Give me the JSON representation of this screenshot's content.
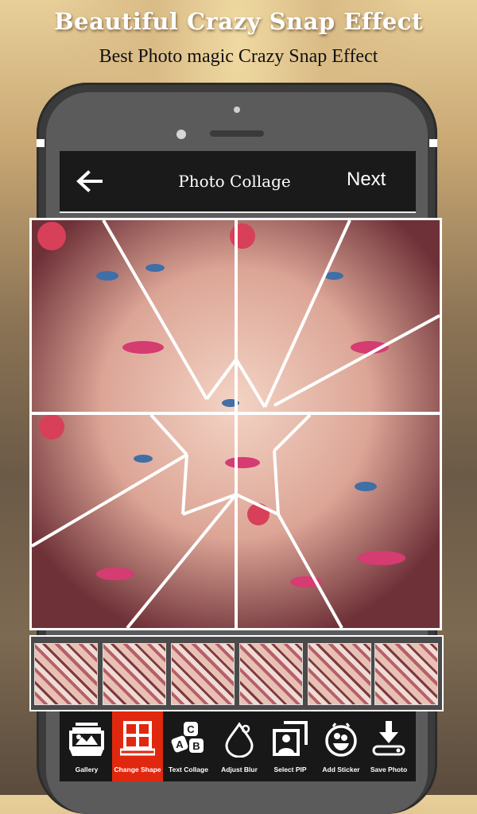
{
  "promo": {
    "title": "Beautiful Crazy Snap Effect",
    "subtitle": "Best Photo magic Crazy Snap Effect"
  },
  "appbar": {
    "back_icon": "arrow-left-icon",
    "title": "Photo Collage",
    "next_label": "Next"
  },
  "collage": {
    "description": "Crazy snap shattered-glass collage of portrait photo",
    "pieces": 11
  },
  "shapes": {
    "thumbnails": [
      {
        "name": "shape-grid-4x3"
      },
      {
        "name": "shape-vertical-shards"
      },
      {
        "name": "shape-polygon-mosaic"
      },
      {
        "name": "shape-radial-shards"
      },
      {
        "name": "shape-large-shards"
      },
      {
        "name": "shape-brick-grid"
      }
    ]
  },
  "toolbar": {
    "accent_color": "#e0280f",
    "items": [
      {
        "label": "Gallery",
        "icon": "gallery-icon",
        "active": false
      },
      {
        "label": "Change Shape",
        "icon": "window-grid-icon",
        "active": true
      },
      {
        "label": "Text Collage",
        "icon": "abc-blocks-icon",
        "active": false
      },
      {
        "label": "Adjust Blur",
        "icon": "water-drop-icon",
        "active": false
      },
      {
        "label": "Select PIP",
        "icon": "picture-in-picture-icon",
        "active": false
      },
      {
        "label": "Add Sticker",
        "icon": "smiley-sticker-icon",
        "active": false
      },
      {
        "label": "Save Photo",
        "icon": "download-icon",
        "active": false
      }
    ]
  }
}
